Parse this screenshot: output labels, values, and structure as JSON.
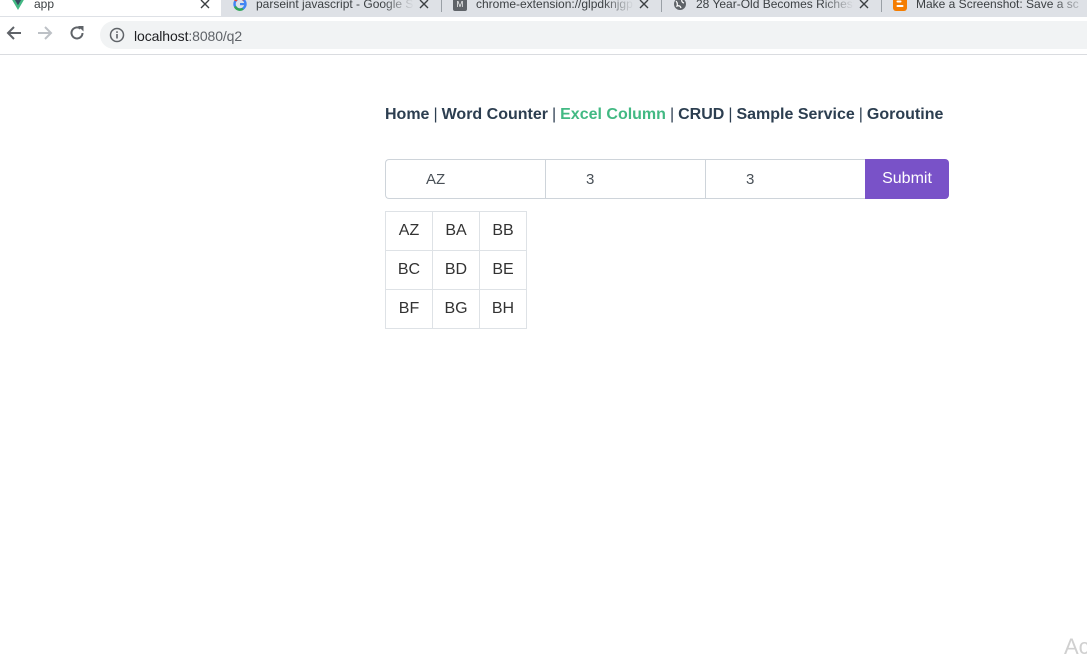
{
  "browser": {
    "tabs": [
      {
        "title": "app",
        "icon": "vue-logo-icon",
        "active": true
      },
      {
        "title": "parseint javascript - Google S",
        "icon": "google-icon",
        "active": false
      },
      {
        "title": "chrome-extension://glpdknjgp",
        "icon": "extension-page-icon",
        "active": false
      },
      {
        "title": "28 Year-Old Becomes Richest",
        "icon": "globe-icon",
        "active": false
      },
      {
        "title": "Make a Screenshot: Save a sc",
        "icon": "blogger-icon",
        "active": false
      }
    ],
    "address_bar": {
      "host": "localhost",
      "path": ":8080/q2"
    },
    "colors": {
      "tab_strip": "#dee1e6",
      "omnibox": "#f1f3f4",
      "vue_green": "#42b883",
      "blogger_orange": "#f57d00"
    }
  },
  "nav": {
    "links": [
      {
        "label": "Home",
        "active": false
      },
      {
        "label": "Word Counter",
        "active": false
      },
      {
        "label": "Excel Column",
        "active": true
      },
      {
        "label": "CRUD",
        "active": false
      },
      {
        "label": "Sample Service",
        "active": false
      },
      {
        "label": "Goroutine",
        "active": false
      }
    ],
    "separator": "|",
    "active_color": "#42b983",
    "text_color": "#2c3e50"
  },
  "form": {
    "start_column": "AZ",
    "rows": "3",
    "columns": "3",
    "submit_label": "Submit",
    "submit_color": "#7952c8"
  },
  "grid": {
    "rows": [
      [
        "AZ",
        "BA",
        "BB"
      ],
      [
        "BC",
        "BD",
        "BE"
      ],
      [
        "BF",
        "BG",
        "BH"
      ]
    ]
  },
  "watermark": {
    "text": "Ac"
  }
}
